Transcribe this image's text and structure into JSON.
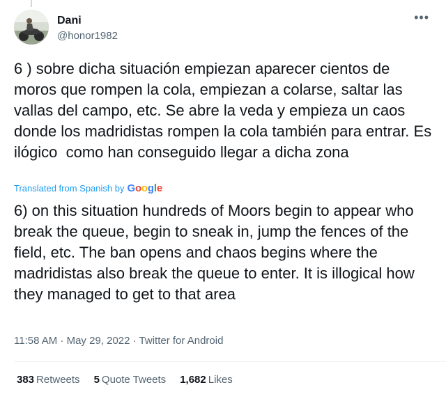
{
  "author": {
    "display_name": "Dani",
    "handle": "@honor1982"
  },
  "more_icon": "more-horizontal-icon",
  "tweet": {
    "text": "6 ) sobre dicha situación empiezan aparecer cientos de moros que rompen la cola, empiezan a colarse, saltar las vallas del campo, etc. Se abre la veda y empieza un caos donde los madridistas rompen la cola también para entrar. Es ilógico  como han conseguido llegar a dicha zona",
    "translated_label": "Translated from Spanish by",
    "translator": {
      "letters": [
        "G",
        "o",
        "o",
        "g",
        "l",
        "e"
      ]
    },
    "translation": "6) on this situation hundreds of Moors begin to appear who break the queue, begin to sneak in, jump the fences of the field, etc. The ban opens and chaos begins where the madridistas also break the queue to enter. It is illogical how they managed to get to that area",
    "meta": "11:58 AM · May 29, 2022 · Twitter for Android"
  },
  "stats": {
    "retweets_count": "383",
    "retweets_label": "Retweets",
    "quotes_count": "5",
    "quotes_label": "Quote Tweets",
    "likes_count": "1,682",
    "likes_label": "Likes"
  },
  "colors": {
    "accent": "#1d9bf0",
    "text": "#0f1419",
    "secondary": "#536471"
  }
}
